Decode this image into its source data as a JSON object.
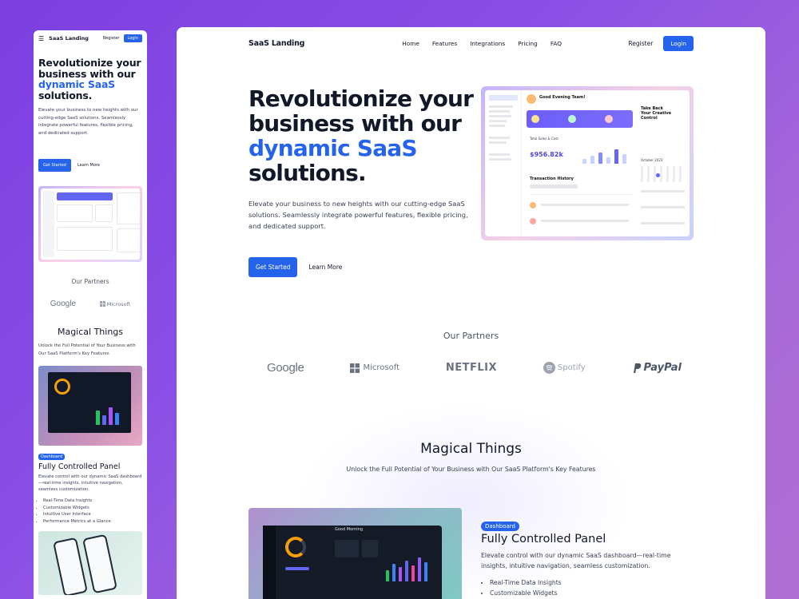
{
  "mobile": {
    "nav": {
      "logo": "SaaS Landing",
      "register": "Register",
      "login": "Login"
    },
    "hero": {
      "title_line1": "Revolutionize your",
      "title_line2": "business with our",
      "title_highlight": "dynamic SaaS",
      "title_line4": "solutions.",
      "description": "Elevate your business to new heights with our cutting-edge SaaS solutions. Seamlessly integrate powerful features, flexible pricing, and dedicated support.",
      "cta_primary": "Get Started",
      "cta_secondary": "Learn More"
    },
    "partners_title": "Our Partners",
    "partners": [
      "Google",
      "Microsoft"
    ],
    "magic_title": "Magical Things",
    "magic_subtitle": "Unlock the Full Potential of Your Business with Our SaaS Platform's Key Features",
    "feature": {
      "badge": "Dashboard",
      "title": "Fully Controlled Panel",
      "description": "Elevate control with our dynamic SaaS dashboard—real-time insights, intuitive navigation, seamless customization.",
      "bullets": [
        "Real-Time Data Insights",
        "Customizable Widgets",
        "Intuitive User Interface",
        "Performance Metrics at a Glance"
      ]
    }
  },
  "desktop": {
    "nav": {
      "logo": "SaaS Landing",
      "menu": [
        "Home",
        "Features",
        "Integrations",
        "Pricing",
        "FAQ"
      ],
      "register": "Register",
      "login": "Login"
    },
    "hero": {
      "title_line1": "Revolutionize your",
      "title_line2": "business with our",
      "title_highlight": "dynamic SaaS",
      "title_line4": "solutions.",
      "description": "Elevate your business to new heights with our cutting-edge SaaS solutions. Seamlessly integrate powerful features, flexible pricing, and dedicated support.",
      "cta_primary": "Get Started",
      "cta_secondary": "Learn More"
    },
    "dashboard_preview": {
      "greeting": "Good Evening Team!",
      "sales_label": "Total Sales & Cost",
      "sales_value": "$956.82k",
      "transactions_title": "Transaction History",
      "side_title": "Take Back Your Creative Control",
      "calendar_month": "October 2023"
    },
    "partners_title": "Our Partners",
    "partners": [
      "Google",
      "Microsoft",
      "NETFLIX",
      "Spotify",
      "PayPal"
    ],
    "magic_title": "Magical Things",
    "magic_subtitle": "Unlock the Full Potential of Your Business with Our SaaS Platform's Key Features",
    "feature": {
      "badge": "Dashboard",
      "title": "Fully Controlled Panel",
      "description": "Elevate control with our dynamic SaaS dashboard—real-time insights, intuitive navigation, seamless customization.",
      "bullets": [
        "Real-Time Data Insights",
        "Customizable Widgets"
      ],
      "preview_label": "Good Morning"
    }
  },
  "colors": {
    "accent": "#2563eb",
    "background_start": "#7c3fe0",
    "background_end": "#b06fd4"
  }
}
